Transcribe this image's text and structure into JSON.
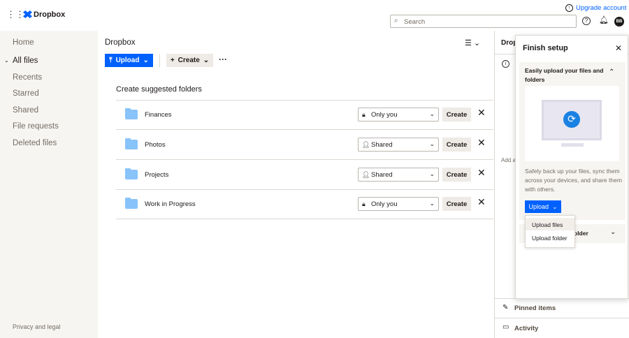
{
  "header": {
    "brand": "Dropbox",
    "upgrade": "Upgrade account",
    "search_placeholder": "Search",
    "avatar": "BB"
  },
  "sidebar": {
    "items": [
      "Home",
      "All files",
      "Recents",
      "Starred",
      "Shared",
      "File requests",
      "Deleted files"
    ],
    "footer": "Privacy and legal"
  },
  "main": {
    "title": "Dropbox",
    "upload": "Upload",
    "create": "Create",
    "section_title": "Create suggested folders",
    "rows": [
      {
        "name": "Finances",
        "access": "Only you",
        "icon": "lock-icon"
      },
      {
        "name": "Photos",
        "access": "Shared",
        "icon": "people-icon"
      },
      {
        "name": "Projects",
        "access": "Shared",
        "icon": "people-icon"
      },
      {
        "name": "Work in Progress",
        "access": "Only you",
        "icon": "lock-icon"
      }
    ],
    "row_create": "Create"
  },
  "right": {
    "header": "Drop",
    "add_text": "Add a",
    "pinned": "Pinned items",
    "activity": "Activity"
  },
  "finish": {
    "title": "Finish setup",
    "card_title": "Easily upload your files and folders",
    "desc": "Safely back up your files, sync them across your devices, and share them with others.",
    "upload": "Upload",
    "second_card": "older",
    "menu": [
      "Upload files",
      "Upload folder"
    ]
  },
  "colors": {
    "accent": "#0061fe",
    "sidebar_bg": "#f7f5f2"
  }
}
